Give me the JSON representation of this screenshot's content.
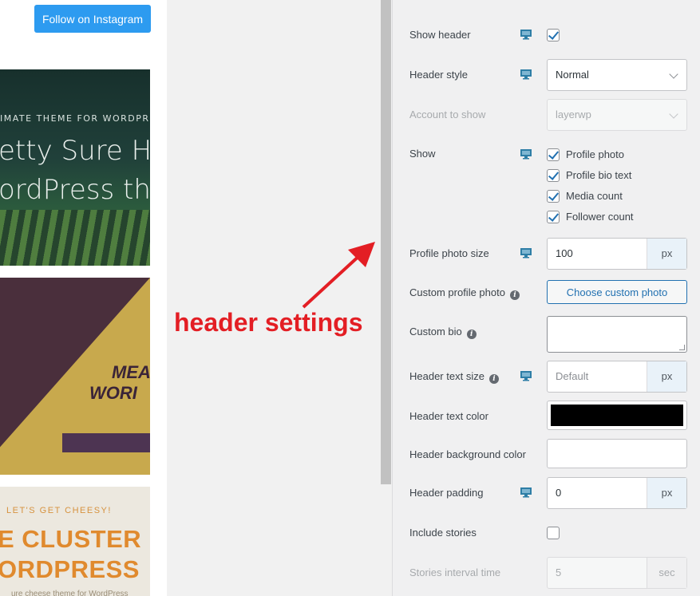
{
  "preview": {
    "follow_label": "Follow on Instagram",
    "tile1": {
      "tag": "IMATE THEME FOR WORDPRESS",
      "line1": "etty Sure H",
      "line2": "ordPress th"
    },
    "tile2": {
      "line1": "MEA",
      "line2": "WORI"
    },
    "tile3": {
      "small": "LET'S GET CHEESY!",
      "line1": "E CLUSTER F",
      "line2": "ORDPRESS",
      "line3": "ure cheese theme for WordPress"
    }
  },
  "annotation": {
    "text": "header settings",
    "color": "#e31e24"
  },
  "settings": {
    "show_header": {
      "label": "Show header",
      "checked": true
    },
    "header_style": {
      "label": "Header style",
      "value": "Normal"
    },
    "account_to_show": {
      "label": "Account to show",
      "value": "layerwp"
    },
    "show": {
      "label": "Show",
      "options": [
        {
          "label": "Profile photo",
          "checked": true
        },
        {
          "label": "Profile bio text",
          "checked": true
        },
        {
          "label": "Media count",
          "checked": true
        },
        {
          "label": "Follower count",
          "checked": true
        }
      ]
    },
    "profile_photo_size": {
      "label": "Profile photo size",
      "value": "100",
      "unit": "px"
    },
    "custom_profile_photo": {
      "label": "Custom profile photo",
      "button": "Choose custom photo"
    },
    "custom_bio": {
      "label": "Custom bio",
      "value": ""
    },
    "header_text_size": {
      "label": "Header text size",
      "placeholder": "Default",
      "unit": "px"
    },
    "header_text_color": {
      "label": "Header text color",
      "value": "#000000"
    },
    "header_background_color": {
      "label": "Header background color",
      "value": "#ffffff"
    },
    "header_padding": {
      "label": "Header padding",
      "value": "0",
      "unit": "px"
    },
    "include_stories": {
      "label": "Include stories",
      "checked": false
    },
    "stories_interval_time": {
      "label": "Stories interval time",
      "value": "5",
      "unit": "sec"
    }
  },
  "icons": {
    "device": "desktop-icon",
    "info": "info-icon"
  },
  "colors": {
    "accent": "#2271b1",
    "follow_button": "#2d9bf0",
    "device_icon": "#2e7ea6"
  }
}
